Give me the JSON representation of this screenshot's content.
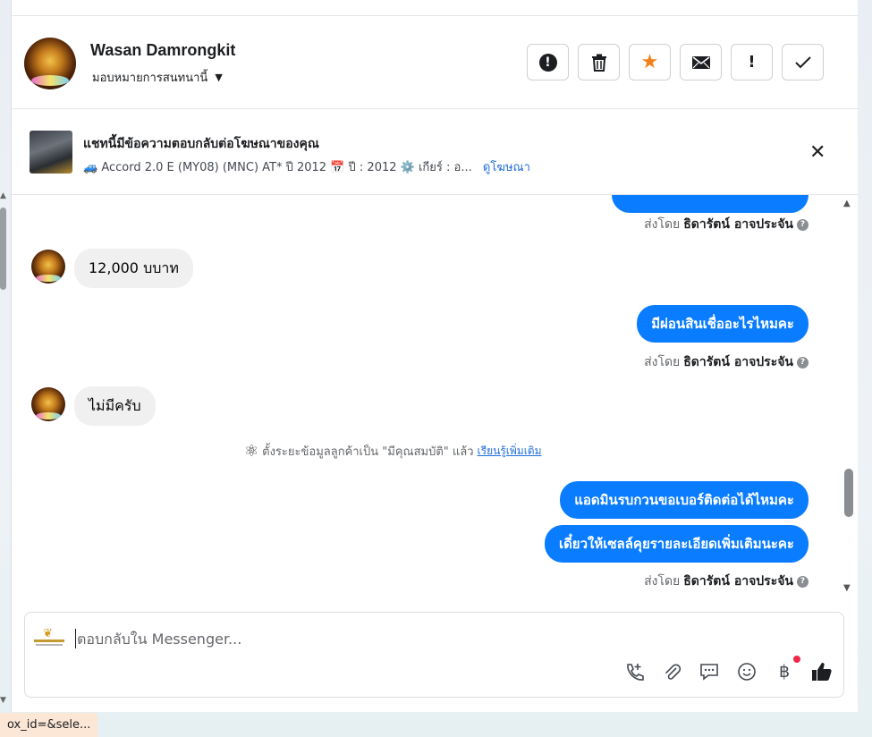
{
  "contact": {
    "name": "Wasan Damrongkit",
    "assign_label": "มอบหมายการสนทนานี้"
  },
  "actions": [
    {
      "name": "report-button",
      "icon": "alert-circle-icon"
    },
    {
      "name": "delete-button",
      "icon": "trash-icon"
    },
    {
      "name": "star-button",
      "icon": "star-icon"
    },
    {
      "name": "mark-unread-button",
      "icon": "envelope-icon"
    },
    {
      "name": "important-button",
      "icon": "exclamation-icon"
    },
    {
      "name": "done-button",
      "icon": "check-icon"
    }
  ],
  "ad": {
    "title": "แชทนี้มีข้อความตอบกลับต่อโฆษณาของคุณ",
    "detail": "🚙 Accord 2.0 E (MY08) (MNC) AT* ปี 2012 📅 ปี : 2012 ⚙️ เกียร์ : อ...",
    "link": "ดูโฆษณา"
  },
  "messages": {
    "sent_by_prefix": "ส่งโดย",
    "agent_name": "ธิดารัตน์ อาจประจัน",
    "in_1": "12,000 บบาท",
    "out_1": "มีผ่อนสินเชื่ออะไรไหมคะ",
    "in_2": "ไม่มีครับ",
    "system_note": "ตั้งระยะข้อมูลลูกค้าเป็น \"มีคุณสมบัติ\" แล้ว",
    "system_link": "เรียนรู้เพิ่มเติม",
    "out_2": "แอดมินรบกวนขอเบอร์ติดต่อได้ไหมคะ",
    "out_3": "เดี๋ยวให้เซลล์คุยรายละเอียดเพิ่มเติมนะคะ"
  },
  "composer": {
    "placeholder": "ตอบกลับใน Messenger..."
  },
  "status_bar": {
    "url": "ox_id=&sele..."
  },
  "colors": {
    "accent": "#0a7cff",
    "star": "#f0811a",
    "link": "#216fdb"
  }
}
